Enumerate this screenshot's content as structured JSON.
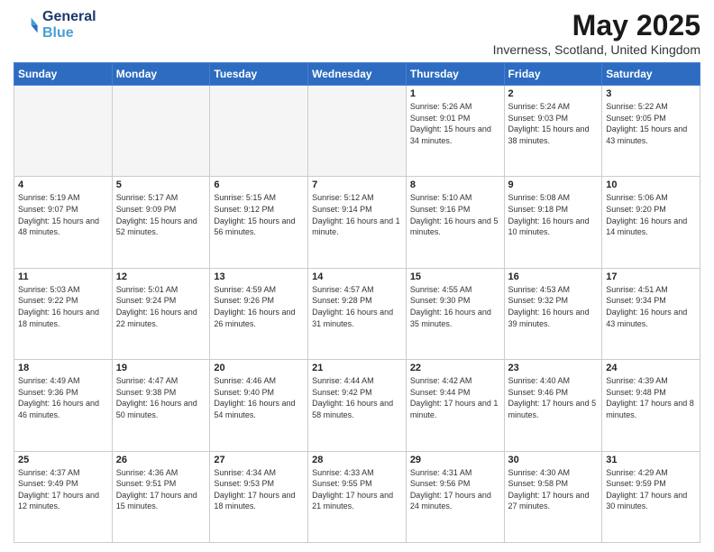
{
  "header": {
    "logo_line1": "General",
    "logo_line2": "Blue",
    "month_title": "May 2025",
    "location": "Inverness, Scotland, United Kingdom"
  },
  "days_of_week": [
    "Sunday",
    "Monday",
    "Tuesday",
    "Wednesday",
    "Thursday",
    "Friday",
    "Saturday"
  ],
  "weeks": [
    [
      {
        "day": "",
        "info": ""
      },
      {
        "day": "",
        "info": ""
      },
      {
        "day": "",
        "info": ""
      },
      {
        "day": "",
        "info": ""
      },
      {
        "day": "1",
        "info": "Sunrise: 5:26 AM\nSunset: 9:01 PM\nDaylight: 15 hours\nand 34 minutes."
      },
      {
        "day": "2",
        "info": "Sunrise: 5:24 AM\nSunset: 9:03 PM\nDaylight: 15 hours\nand 38 minutes."
      },
      {
        "day": "3",
        "info": "Sunrise: 5:22 AM\nSunset: 9:05 PM\nDaylight: 15 hours\nand 43 minutes."
      }
    ],
    [
      {
        "day": "4",
        "info": "Sunrise: 5:19 AM\nSunset: 9:07 PM\nDaylight: 15 hours\nand 48 minutes."
      },
      {
        "day": "5",
        "info": "Sunrise: 5:17 AM\nSunset: 9:09 PM\nDaylight: 15 hours\nand 52 minutes."
      },
      {
        "day": "6",
        "info": "Sunrise: 5:15 AM\nSunset: 9:12 PM\nDaylight: 15 hours\nand 56 minutes."
      },
      {
        "day": "7",
        "info": "Sunrise: 5:12 AM\nSunset: 9:14 PM\nDaylight: 16 hours\nand 1 minute."
      },
      {
        "day": "8",
        "info": "Sunrise: 5:10 AM\nSunset: 9:16 PM\nDaylight: 16 hours\nand 5 minutes."
      },
      {
        "day": "9",
        "info": "Sunrise: 5:08 AM\nSunset: 9:18 PM\nDaylight: 16 hours\nand 10 minutes."
      },
      {
        "day": "10",
        "info": "Sunrise: 5:06 AM\nSunset: 9:20 PM\nDaylight: 16 hours\nand 14 minutes."
      }
    ],
    [
      {
        "day": "11",
        "info": "Sunrise: 5:03 AM\nSunset: 9:22 PM\nDaylight: 16 hours\nand 18 minutes."
      },
      {
        "day": "12",
        "info": "Sunrise: 5:01 AM\nSunset: 9:24 PM\nDaylight: 16 hours\nand 22 minutes."
      },
      {
        "day": "13",
        "info": "Sunrise: 4:59 AM\nSunset: 9:26 PM\nDaylight: 16 hours\nand 26 minutes."
      },
      {
        "day": "14",
        "info": "Sunrise: 4:57 AM\nSunset: 9:28 PM\nDaylight: 16 hours\nand 31 minutes."
      },
      {
        "day": "15",
        "info": "Sunrise: 4:55 AM\nSunset: 9:30 PM\nDaylight: 16 hours\nand 35 minutes."
      },
      {
        "day": "16",
        "info": "Sunrise: 4:53 AM\nSunset: 9:32 PM\nDaylight: 16 hours\nand 39 minutes."
      },
      {
        "day": "17",
        "info": "Sunrise: 4:51 AM\nSunset: 9:34 PM\nDaylight: 16 hours\nand 43 minutes."
      }
    ],
    [
      {
        "day": "18",
        "info": "Sunrise: 4:49 AM\nSunset: 9:36 PM\nDaylight: 16 hours\nand 46 minutes."
      },
      {
        "day": "19",
        "info": "Sunrise: 4:47 AM\nSunset: 9:38 PM\nDaylight: 16 hours\nand 50 minutes."
      },
      {
        "day": "20",
        "info": "Sunrise: 4:46 AM\nSunset: 9:40 PM\nDaylight: 16 hours\nand 54 minutes."
      },
      {
        "day": "21",
        "info": "Sunrise: 4:44 AM\nSunset: 9:42 PM\nDaylight: 16 hours\nand 58 minutes."
      },
      {
        "day": "22",
        "info": "Sunrise: 4:42 AM\nSunset: 9:44 PM\nDaylight: 17 hours\nand 1 minute."
      },
      {
        "day": "23",
        "info": "Sunrise: 4:40 AM\nSunset: 9:46 PM\nDaylight: 17 hours\nand 5 minutes."
      },
      {
        "day": "24",
        "info": "Sunrise: 4:39 AM\nSunset: 9:48 PM\nDaylight: 17 hours\nand 8 minutes."
      }
    ],
    [
      {
        "day": "25",
        "info": "Sunrise: 4:37 AM\nSunset: 9:49 PM\nDaylight: 17 hours\nand 12 minutes."
      },
      {
        "day": "26",
        "info": "Sunrise: 4:36 AM\nSunset: 9:51 PM\nDaylight: 17 hours\nand 15 minutes."
      },
      {
        "day": "27",
        "info": "Sunrise: 4:34 AM\nSunset: 9:53 PM\nDaylight: 17 hours\nand 18 minutes."
      },
      {
        "day": "28",
        "info": "Sunrise: 4:33 AM\nSunset: 9:55 PM\nDaylight: 17 hours\nand 21 minutes."
      },
      {
        "day": "29",
        "info": "Sunrise: 4:31 AM\nSunset: 9:56 PM\nDaylight: 17 hours\nand 24 minutes."
      },
      {
        "day": "30",
        "info": "Sunrise: 4:30 AM\nSunset: 9:58 PM\nDaylight: 17 hours\nand 27 minutes."
      },
      {
        "day": "31",
        "info": "Sunrise: 4:29 AM\nSunset: 9:59 PM\nDaylight: 17 hours\nand 30 minutes."
      }
    ]
  ]
}
